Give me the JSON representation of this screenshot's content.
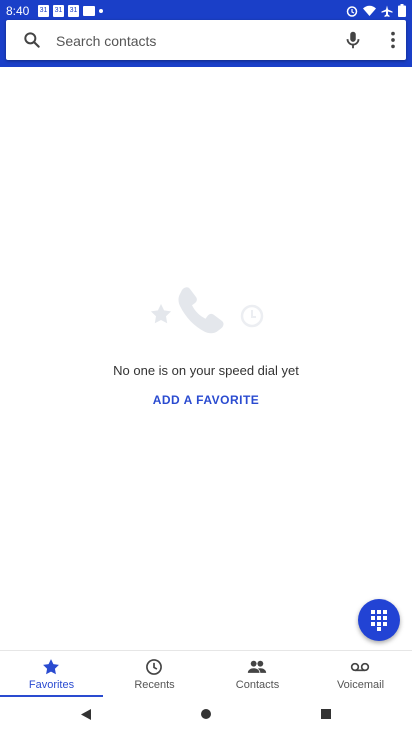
{
  "status_bar": {
    "time": "8:40",
    "left_icons": [
      "calendar-icon",
      "calendar-icon",
      "calendar-icon",
      "voicemail-icon",
      "dot-icon"
    ],
    "right_icons": [
      "alarm-icon",
      "wifi-icon",
      "airplane-icon",
      "battery-icon"
    ]
  },
  "search": {
    "placeholder": "Search contacts"
  },
  "empty_state": {
    "message": "No one is on your speed dial yet",
    "action_label": "ADD A FAVORITE"
  },
  "bottom_nav": {
    "items": [
      {
        "label": "Favorites",
        "icon": "star-icon",
        "active": true
      },
      {
        "label": "Recents",
        "icon": "clock-icon",
        "active": false
      },
      {
        "label": "Contacts",
        "icon": "people-icon",
        "active": false
      },
      {
        "label": "Voicemail",
        "icon": "voicemail-icon",
        "active": false
      }
    ]
  },
  "colors": {
    "primary": "#1a3fc8",
    "accent": "#2a4bd0"
  }
}
